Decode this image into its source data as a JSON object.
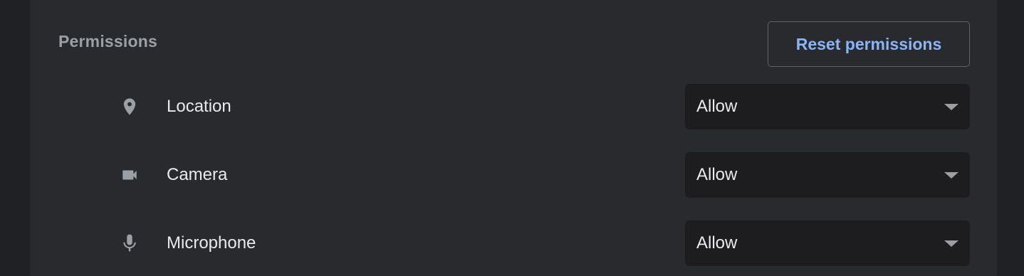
{
  "section": {
    "title": "Permissions",
    "reset_label": "Reset permissions"
  },
  "permissions": [
    {
      "label": "Location",
      "icon": "location-pin-icon",
      "value": "Allow"
    },
    {
      "label": "Camera",
      "icon": "video-camera-icon",
      "value": "Allow"
    },
    {
      "label": "Microphone",
      "icon": "microphone-icon",
      "value": "Allow"
    }
  ],
  "colors": {
    "page_background": "#202124",
    "card_background": "#292a2d",
    "select_background": "#1d1d1f",
    "accent": "#8ab4f8",
    "muted_text": "#9aa0a6",
    "primary_text": "#e8eaed"
  }
}
